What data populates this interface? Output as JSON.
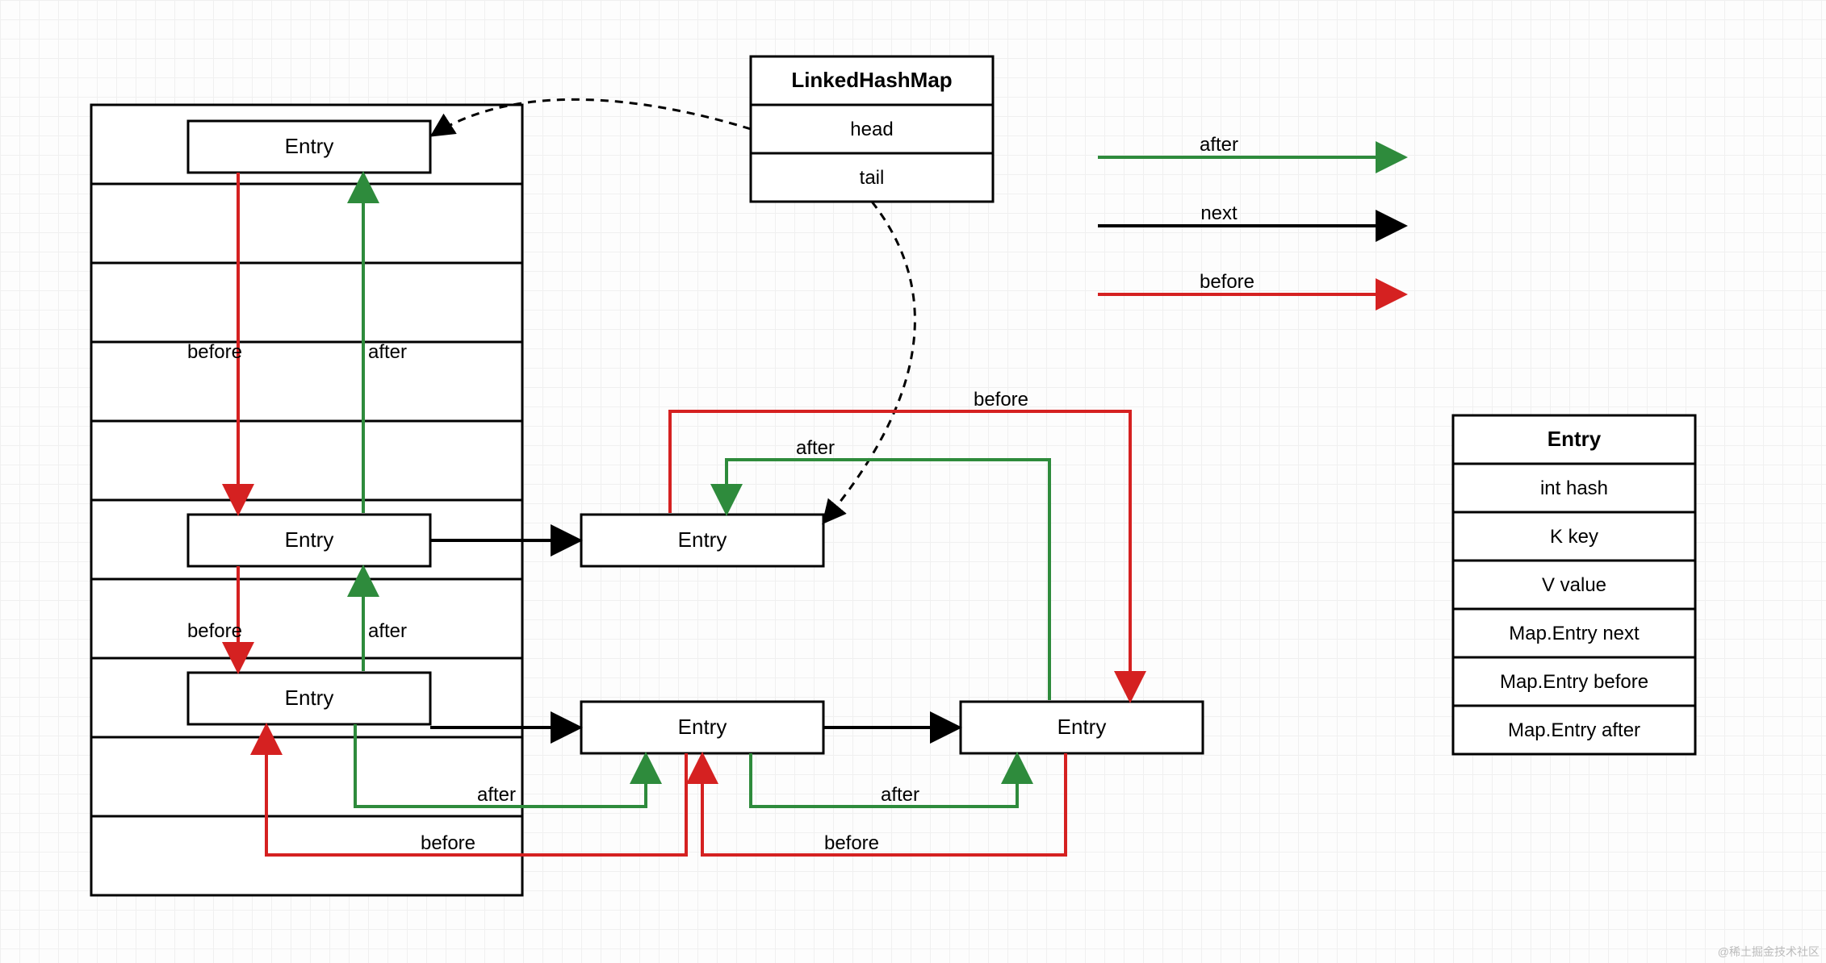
{
  "linkedHashMap": {
    "title": "LinkedHashMap",
    "head": "head",
    "tail": "tail"
  },
  "legend": {
    "after": "after",
    "next": "next",
    "before": "before"
  },
  "entryStruct": {
    "title": "Entry",
    "fields": [
      "int hash",
      "K key",
      "V value",
      "Map.Entry next",
      "Map.Entry before",
      "Map.Entry after"
    ]
  },
  "entries": {
    "bucketTopLeft": "Entry",
    "bucketMidLeft": "Entry",
    "bucketBotLeft": "Entry",
    "midRight": "Entry",
    "lowMid": "Entry",
    "lowRight": "Entry"
  },
  "edgeLabels": {
    "before": "before",
    "after": "after"
  },
  "watermark": "@稀土掘金技术社区"
}
